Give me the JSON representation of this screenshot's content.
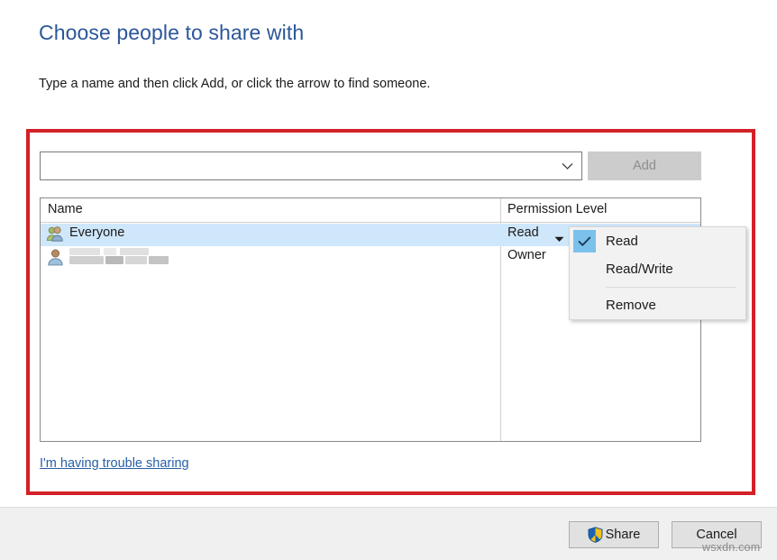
{
  "dialog": {
    "title": "Choose people to share with",
    "subtitle": "Type a name and then click Add, or click the arrow to find someone."
  },
  "combo": {
    "value": "",
    "placeholder": "",
    "arrow_icon": "chevron-down-icon"
  },
  "add_button": {
    "label": "Add",
    "enabled": false
  },
  "permissions_list": {
    "columns": [
      "Name",
      "Permission Level"
    ],
    "rows": [
      {
        "icon": "group-users-icon",
        "name": "Everyone",
        "permission": "Read",
        "selected": true,
        "has_dropdown": true,
        "redacted": false
      },
      {
        "icon": "single-user-icon",
        "name": "",
        "permission": "Owner",
        "selected": false,
        "has_dropdown": false,
        "redacted": true
      }
    ]
  },
  "permission_menu": {
    "open": true,
    "items": [
      {
        "label": "Read",
        "checked": true
      },
      {
        "label": "Read/Write",
        "checked": false
      },
      {
        "label": "Remove",
        "checked": false
      }
    ],
    "separator_before_index": 2
  },
  "links": {
    "trouble": "I'm having trouble sharing"
  },
  "footer": {
    "share_label": "Share",
    "share_icon": "uac-shield-icon",
    "cancel_label": "Cancel"
  },
  "watermark": "wsxdn.com",
  "colors": {
    "title_blue": "#2b579a",
    "link_blue": "#2860a8",
    "selection_blue": "#cfe7fb",
    "annotation_red": "#d42027",
    "menu_background": "#f2f2f2",
    "check_highlight": "#7cc0ec",
    "disabled_button": "#cccccc"
  }
}
